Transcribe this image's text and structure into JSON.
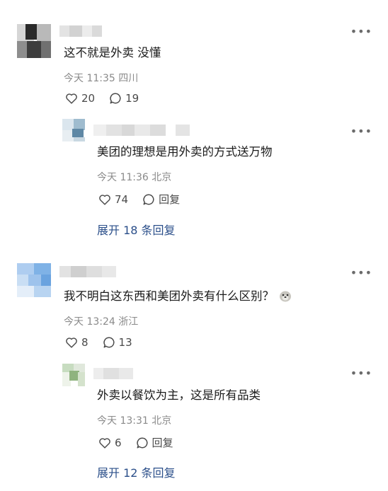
{
  "comments": [
    {
      "text": "这不就是外卖 没懂",
      "meta": "今天 11:35 四川",
      "likes": "20",
      "replies_count": "19",
      "reply": {
        "text": "美团的理想是用外卖的方式送万物",
        "meta": "今天 11:36 北京",
        "likes": "74",
        "reply_label": "回复"
      },
      "expand_label": "展开 18 条回复"
    },
    {
      "text": "我不明白这东西和美团外卖有什么区别？",
      "meta": "今天 13:24 浙江",
      "likes": "8",
      "replies_count": "13",
      "reply": {
        "text": "外卖以餐饮为主，这是所有品类",
        "meta": "今天 13:31 北京",
        "likes": "6",
        "reply_label": "回复"
      },
      "expand_label": "展开 12 条回复"
    }
  ],
  "more_icon": "more-horizontal-icon",
  "like_icon": "heart-outline-icon",
  "reply_icon": "speech-bubble-icon",
  "emoji_icon": "doge-emoji-icon"
}
